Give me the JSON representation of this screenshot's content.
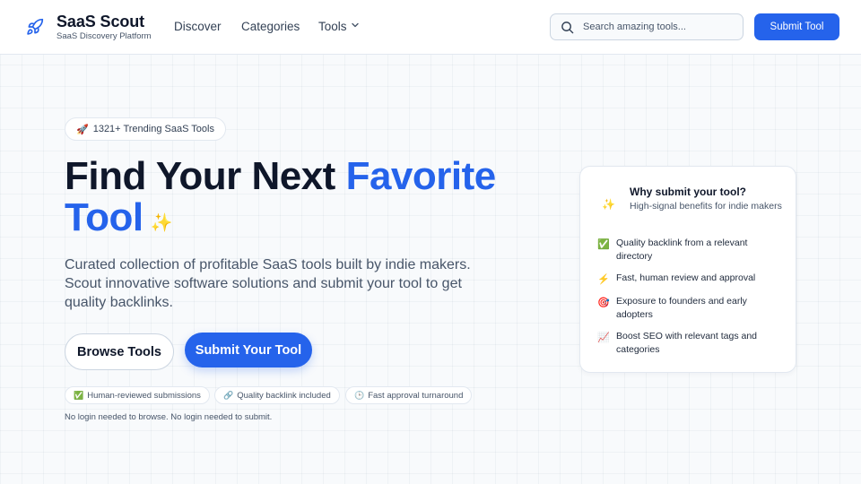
{
  "header": {
    "brand_name": "SaaS Scout",
    "brand_tagline": "SaaS Discovery Platform",
    "nav": {
      "discover": "Discover",
      "categories": "Categories",
      "tools": "Tools"
    },
    "search_placeholder": "Search amazing tools...",
    "submit_button": "Submit Tool"
  },
  "hero": {
    "badge": "1321+ Trending SaaS Tools",
    "title_part1": "Find Your Next ",
    "title_accent": "Favorite Tool",
    "description": "Curated collection of profitable SaaS tools built by indie makers. Scout innovative software solutions and submit your tool to get quality backlinks.",
    "browse_button": "Browse Tools",
    "submit_button": "Submit Your Tool",
    "chips": [
      "Human-reviewed submissions",
      "Quality backlink included",
      "Fast approval turnaround"
    ],
    "footnote": "No login needed to browse. No login needed to submit."
  },
  "card": {
    "title": "Why submit your tool?",
    "subtitle": "High-signal benefits for indie makers",
    "benefits": [
      "Quality backlink from a relevant directory",
      "Fast, human review and approval",
      "Exposure to founders and early adopters",
      "Boost SEO with relevant tags and categories"
    ]
  },
  "icons": {
    "logo": "rocket-icon",
    "tools_dropdown": "chevron-down-icon",
    "search": "search-icon",
    "badge": "rocket-emoji",
    "title_decoration": "sparkles-emoji",
    "chips": [
      "check-mark-emoji",
      "link-emoji",
      "clock-emoji"
    ],
    "benefits": [
      "check-mark-emoji",
      "lightning-emoji",
      "target-emoji",
      "chart-increasing-emoji"
    ]
  },
  "colors": {
    "accent": "#2563eb",
    "text": "#0f172a",
    "muted": "#475569"
  }
}
